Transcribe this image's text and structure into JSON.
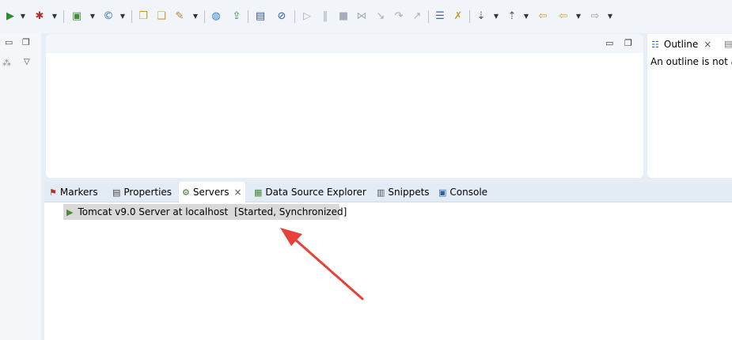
{
  "toolbar": {
    "icons": [
      "run-icon",
      "debug-icon",
      "new-server-icon",
      "new-class-icon",
      "open-folder-icon",
      "open-file-icon",
      "launch-icon",
      "globe-icon",
      "deploy-icon",
      "monitor-icon",
      "skip-breakpoints-icon",
      "resume-icon",
      "suspend-icon",
      "terminate-icon",
      "disconnect-icon",
      "step-into-icon",
      "step-over-icon",
      "step-return-icon",
      "open-task-icon",
      "search-icon",
      "next-annotation-icon",
      "prev-annotation-icon",
      "last-edit-icon",
      "back-icon",
      "forward-icon"
    ]
  },
  "outline": {
    "tab_label": "Outline",
    "close_glyph": "×",
    "message": "An outline is not a"
  },
  "panel": {
    "tabs": [
      {
        "label": "Markers"
      },
      {
        "label": "Properties"
      },
      {
        "label": "Servers",
        "close_glyph": "×"
      },
      {
        "label": "Data Source Explorer"
      },
      {
        "label": "Snippets"
      },
      {
        "label": "Console"
      }
    ],
    "server": {
      "name": "Tomcat v9.0 Server at localhost",
      "status": "[Started, Synchronized]"
    }
  },
  "colors": {
    "arrow": "#e8403a",
    "selection": "#d9d9d9",
    "tabbar": "#e3ebf5"
  }
}
